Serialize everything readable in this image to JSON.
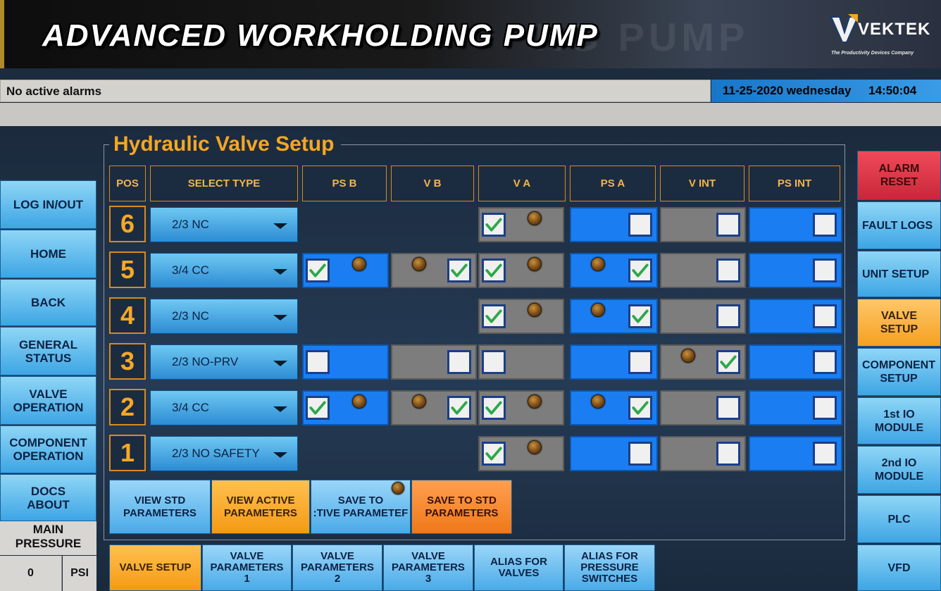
{
  "header": {
    "title": "ADVANCED WORKHOLDING PUMP",
    "ghost": "NG PUMP",
    "logo": "VEKTEK",
    "logo_tagline": "The Productivity Devices Company"
  },
  "status": {
    "alarm_text": "No active alarms",
    "date": "11-25-2020 wednesday",
    "time": "14:50:04"
  },
  "panel": {
    "title": "Hydraulic Valve Setup",
    "columns": [
      "POS",
      "SELECT TYPE",
      "PS B",
      "V B",
      "V A",
      "PS A",
      "V INT",
      "PS INT"
    ],
    "rows": [
      {
        "pos": "6",
        "type": "2/3 NC",
        "cells": [
          null,
          null,
          {
            "bg": "gray",
            "checked": true,
            "led": true
          },
          {
            "bg": "blue",
            "checked": false,
            "led": false
          },
          {
            "bg": "gray",
            "checked": false,
            "led": false
          },
          {
            "bg": "blue",
            "checked": false,
            "led": false
          }
        ]
      },
      {
        "pos": "5",
        "type": "3/4 CC",
        "cells": [
          {
            "bg": "blue",
            "checked": true,
            "led": true
          },
          {
            "bg": "gray",
            "checked": true,
            "led": true
          },
          {
            "bg": "gray",
            "checked": true,
            "led": true
          },
          {
            "bg": "blue",
            "checked": true,
            "led": true
          },
          {
            "bg": "gray",
            "checked": false,
            "led": false
          },
          {
            "bg": "blue",
            "checked": false,
            "led": false
          }
        ]
      },
      {
        "pos": "4",
        "type": "2/3 NC",
        "cells": [
          null,
          null,
          {
            "bg": "gray",
            "checked": true,
            "led": true
          },
          {
            "bg": "blue",
            "checked": true,
            "led": true
          },
          {
            "bg": "gray",
            "checked": false,
            "led": false
          },
          {
            "bg": "blue",
            "checked": false,
            "led": false
          }
        ]
      },
      {
        "pos": "3",
        "type": "2/3 NO-PRV",
        "cells": [
          {
            "bg": "blue",
            "checked": false,
            "led": false
          },
          {
            "bg": "gray",
            "checked": false,
            "led": false
          },
          {
            "bg": "gray",
            "checked": false,
            "led": false
          },
          {
            "bg": "blue",
            "checked": false,
            "led": false
          },
          {
            "bg": "gray",
            "checked": true,
            "led": true
          },
          {
            "bg": "blue",
            "checked": false,
            "led": false
          }
        ]
      },
      {
        "pos": "2",
        "type": "3/4 CC",
        "cells": [
          {
            "bg": "blue",
            "checked": true,
            "led": true
          },
          {
            "bg": "gray",
            "checked": true,
            "led": true
          },
          {
            "bg": "gray",
            "checked": true,
            "led": true
          },
          {
            "bg": "blue",
            "checked": true,
            "led": true
          },
          {
            "bg": "gray",
            "checked": false,
            "led": false
          },
          {
            "bg": "blue",
            "checked": false,
            "led": false
          }
        ]
      },
      {
        "pos": "1",
        "type": "2/3 NO SAFETY",
        "cells": [
          null,
          null,
          {
            "bg": "gray",
            "checked": true,
            "led": true
          },
          {
            "bg": "blue",
            "checked": false,
            "led": false
          },
          {
            "bg": "gray",
            "checked": false,
            "led": false
          },
          {
            "bg": "blue",
            "checked": false,
            "led": false
          }
        ]
      }
    ]
  },
  "actions": {
    "view_std": "VIEW STD\nPARAMETERS",
    "view_active": "VIEW ACTIVE\nPARAMETERS",
    "save_active": "SAVE TO\n:TIVE PARAMETEF",
    "save_std": "SAVE TO STD\nPARAMETERS"
  },
  "left_nav": [
    "LOG IN/OUT",
    "HOME",
    "BACK",
    "GENERAL\nSTATUS",
    "VALVE\nOPERATION",
    "COMPONENT\nOPERATION",
    "DOCS\nABOUT"
  ],
  "pressure": {
    "label": "MAIN\nPRESSURE",
    "value": "0",
    "unit": "PSI"
  },
  "right_nav": [
    "ALARM\nRESET",
    "FAULT LOGS",
    "UNIT SETUP",
    "VALVE\nSETUP",
    "COMPONENT\nSETUP",
    "1st IO\nMODULE",
    "2nd IO\nMODULE",
    "PLC",
    "VFD"
  ],
  "tabs": [
    "VALVE  SETUP",
    "VALVE\nPARAMETERS\n1",
    "VALVE\nPARAMETERS\n2",
    "VALVE\nPARAMETERS\n3",
    "ALIAS FOR\nVALVES",
    "ALIAS FOR\nPRESSURE\nSWITCHES"
  ]
}
